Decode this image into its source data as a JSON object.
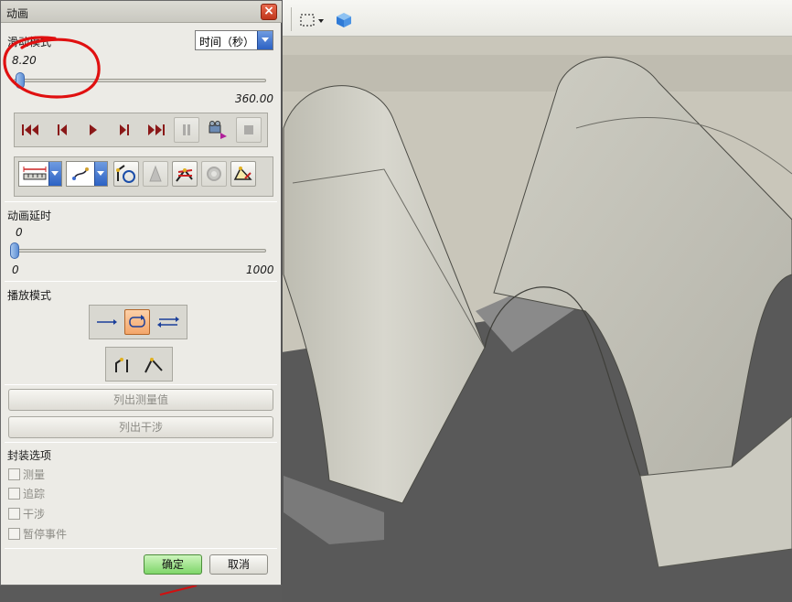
{
  "dialog": {
    "title": "动画",
    "close_glyph": "×"
  },
  "slider_section": {
    "label": "滑动模式",
    "unit_select": {
      "selected": "时间（秒）"
    },
    "current_value": "8.20",
    "max_value": "360.00",
    "current_fraction": 0.023
  },
  "delay_section": {
    "label": "动画延时",
    "current_value": "0",
    "min_value": "0",
    "max_value": "1000",
    "current_fraction": 0.0
  },
  "playback_controls": [
    "to-start-icon",
    "step-back-icon",
    "play-icon",
    "step-forward-icon",
    "to-end-icon",
    "pause-icon",
    "record-movie-icon",
    "stop-icon"
  ],
  "tool_controls": [
    "measure-icon",
    "trace-icon",
    "interference-icon",
    "solid-icon",
    "exploded-view-icon",
    "gear-icon",
    "snapshot-icon"
  ],
  "play_mode": {
    "label": "播放模式",
    "modes": [
      "once-icon",
      "loop-icon",
      "reverse-icon"
    ],
    "active_mode": "loop"
  },
  "actions": {
    "list_measurements": "列出测量值",
    "list_interference": "列出干涉"
  },
  "encapsulation": {
    "label": "封装选项",
    "options": [
      {
        "label": "测量",
        "checked": false
      },
      {
        "label": "追踪",
        "checked": false
      },
      {
        "label": "干涉",
        "checked": false
      },
      {
        "label": "暂停事件",
        "checked": false
      }
    ]
  },
  "footer": {
    "ok": "确定",
    "cancel": "取消"
  },
  "colors": {
    "accent_blue": "#2c62c4",
    "ok_green": "#7fd66a",
    "annotation_red": "#e01010",
    "model_surface": "#c8c7bd",
    "viewport_bg": "#5a5a5a"
  }
}
